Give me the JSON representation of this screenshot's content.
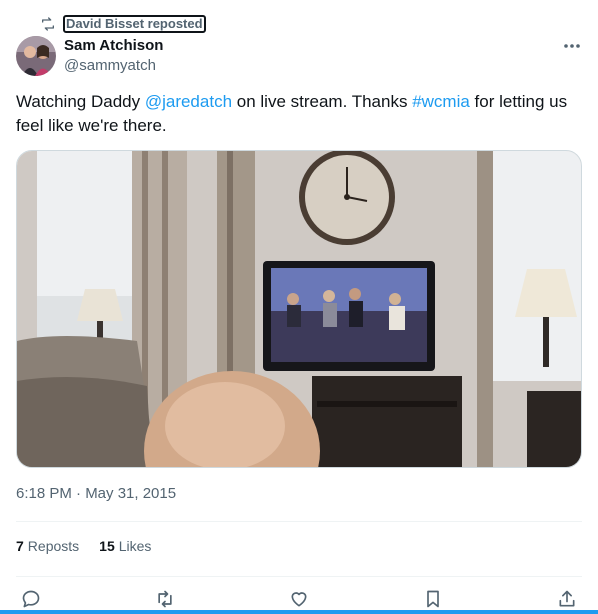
{
  "repost": {
    "label": "David Bisset reposted"
  },
  "author": {
    "name": "Sam Atchison",
    "handle": "@sammyatch"
  },
  "tweet": {
    "text_1": "Watching Daddy ",
    "mention": "@jaredatch",
    "text_2": " on live stream. Thanks ",
    "hashtag": "#wcmia",
    "text_3": " for letting us feel like we're there."
  },
  "timestamp": "6:18 PM · May 31, 2015",
  "stats": {
    "reposts_count": "7",
    "reposts_label": "Reposts",
    "likes_count": "15",
    "likes_label": "Likes"
  },
  "icons": {
    "repost": "repost-icon",
    "more": "more-icon",
    "reply": "reply-icon",
    "retweet": "retweet-icon",
    "like": "like-icon",
    "bookmark": "bookmark-icon",
    "share": "share-icon"
  },
  "colors": {
    "accent": "#1d9bf0",
    "text": "#0f1419",
    "secondary": "#536471"
  }
}
